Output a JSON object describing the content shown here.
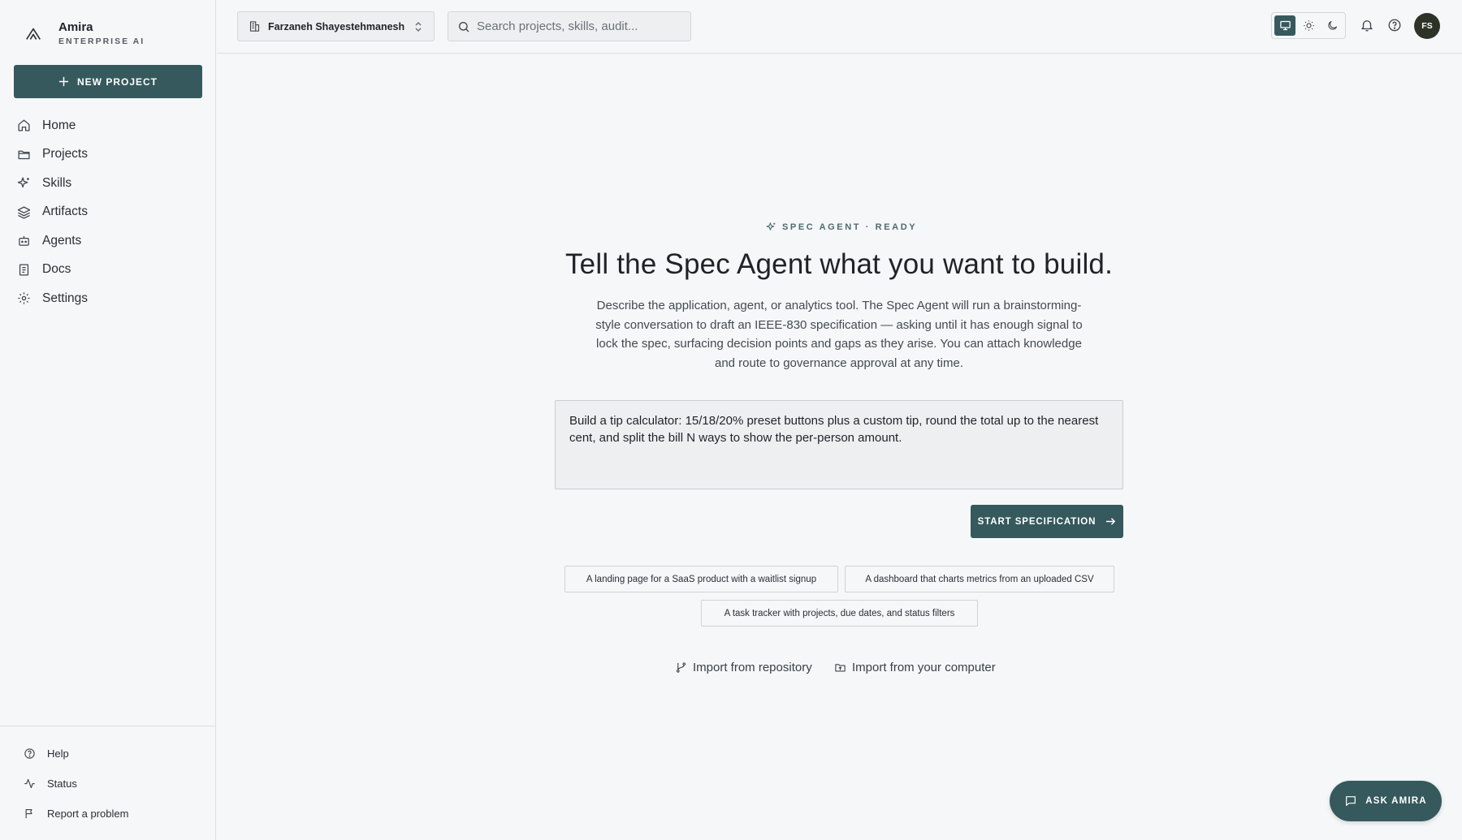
{
  "brand": {
    "name": "Amira",
    "subtitle": "ENTERPRISE AI",
    "logo_icon": "amira-logo-icon"
  },
  "sidebar": {
    "new_project_label": "NEW PROJECT",
    "items": [
      {
        "label": "Home",
        "icon": "home-icon"
      },
      {
        "label": "Projects",
        "icon": "folder-icon"
      },
      {
        "label": "Skills",
        "icon": "sparkles-icon"
      },
      {
        "label": "Artifacts",
        "icon": "layers-icon"
      },
      {
        "label": "Agents",
        "icon": "bot-icon"
      },
      {
        "label": "Docs",
        "icon": "book-icon"
      },
      {
        "label": "Settings",
        "icon": "gear-icon"
      }
    ],
    "footer": [
      {
        "label": "Help",
        "icon": "help-circle-icon"
      },
      {
        "label": "Status",
        "icon": "activity-icon"
      },
      {
        "label": "Report a problem",
        "icon": "flag-icon"
      }
    ]
  },
  "topbar": {
    "workspace": "Farzaneh Shayestehmanesh",
    "search_placeholder": "Search projects, skills, audit...",
    "theme_options": [
      "system",
      "light",
      "dark"
    ],
    "theme_selected": "system",
    "avatar_initials": "FS"
  },
  "main": {
    "eyebrow": "SPEC AGENT · READY",
    "headline": "Tell the Spec Agent what you want to build.",
    "description": "Describe the application, agent, or analytics tool. The Spec Agent will run a brainstorming-style conversation to draft an IEEE-830 specification — asking until it has enough signal to lock the spec, surfacing decision points and gaps as they arise. You can attach knowledge and route to governance approval at any time.",
    "prompt_value": "Build a tip calculator: 15/18/20% preset buttons plus a custom tip, round the total up to the nearest cent, and split the bill N ways to show the per-person amount.",
    "start_label": "START SPECIFICATION",
    "suggestions": [
      "A landing page for a SaaS product with a waitlist signup",
      "A dashboard that charts metrics from an uploaded CSV",
      "A task tracker with projects, due dates, and status filters"
    ],
    "import_repo": "Import from repository",
    "import_computer": "Import from your computer"
  },
  "ask_button": "ASK AMIRA",
  "colors": {
    "accent": "#35595d",
    "background": "#f6f7f9",
    "border": "#dcdfe3"
  }
}
